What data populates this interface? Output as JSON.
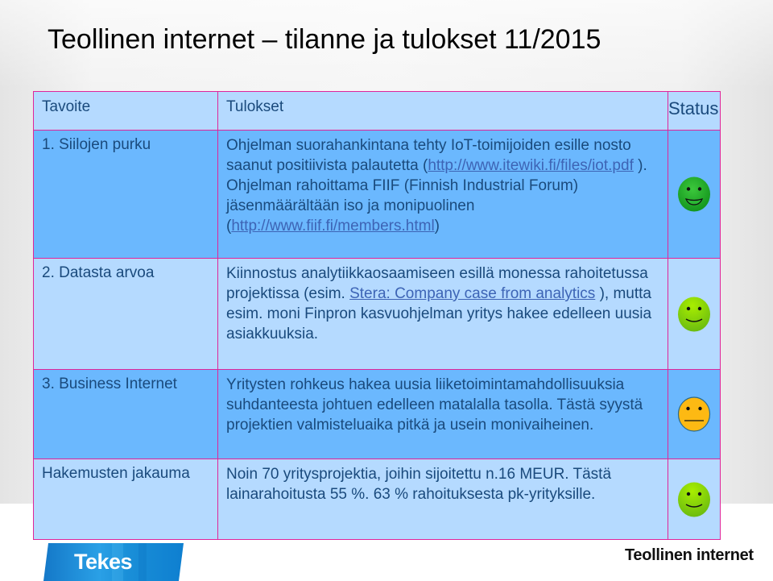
{
  "slide": {
    "title": "Teollinen internet – tilanne ja tulokset 11/2015"
  },
  "table": {
    "headers": {
      "goal": "Tavoite",
      "result": "Tulokset",
      "status": "Status"
    },
    "rows": [
      {
        "goal": "1. Siilojen purku",
        "result": {
          "text_1": "Ohjelman suorahankintana tehty IoT-toimijoiden esille nosto saanut positiivista palautetta (",
          "link_1": "http://www.itewiki.fi/files/iot.pdf",
          "text_2": " ). Ohjelman rahoittama FIIF (Finnish Industrial Forum) jäsenmäärältään iso ja monipuolinen (",
          "link_2": "http://www.fiif.fi/members.html",
          "text_3": ")"
        },
        "status": "very-happy",
        "status_color": "#22aa2e"
      },
      {
        "goal": "2. Datasta arvoa",
        "result": {
          "text_1": "Kiinnostus analytiikkaosaamiseen esillä monessa rahoitetussa projektissa (esim. ",
          "link_1": "Stera: Company case from analytics",
          "text_2": " ), mutta esim. moni Finpron kasvuohjelman yritys hakee edelleen uusia asiakkuuksia."
        },
        "status": "happy",
        "status_color": "#8ed600"
      },
      {
        "goal": "3. Business Internet",
        "result": {
          "text_1": "Yritysten rohkeus hakea uusia liiketoimintamahdollisuuksia suhdanteesta johtuen edelleen matalalla tasolla. Tästä syystä projektien valmisteluaika pitkä ja usein monivaiheinen."
        },
        "status": "neutral",
        "status_color": "#fdb913"
      },
      {
        "goal": "Hakemusten jakauma",
        "result": {
          "text_1": "Noin 70 yritysprojektia, joihin sijoitettu n.16 MEUR. Tästä lainarahoitusta 55 %. 63 % rahoituksesta pk-yrityksille."
        },
        "status": "happy",
        "status_color": "#8ed600"
      }
    ]
  },
  "footer": {
    "logo_text": "Tekes",
    "logo_color": "#1a8fd8",
    "brand_text": "Teollinen internet"
  },
  "colors": {
    "border": "#e0259a",
    "row_light": "#b5daff",
    "row_dark": "#6bb8fe",
    "text": "#1a4a7c",
    "link": "#3d64b5"
  }
}
